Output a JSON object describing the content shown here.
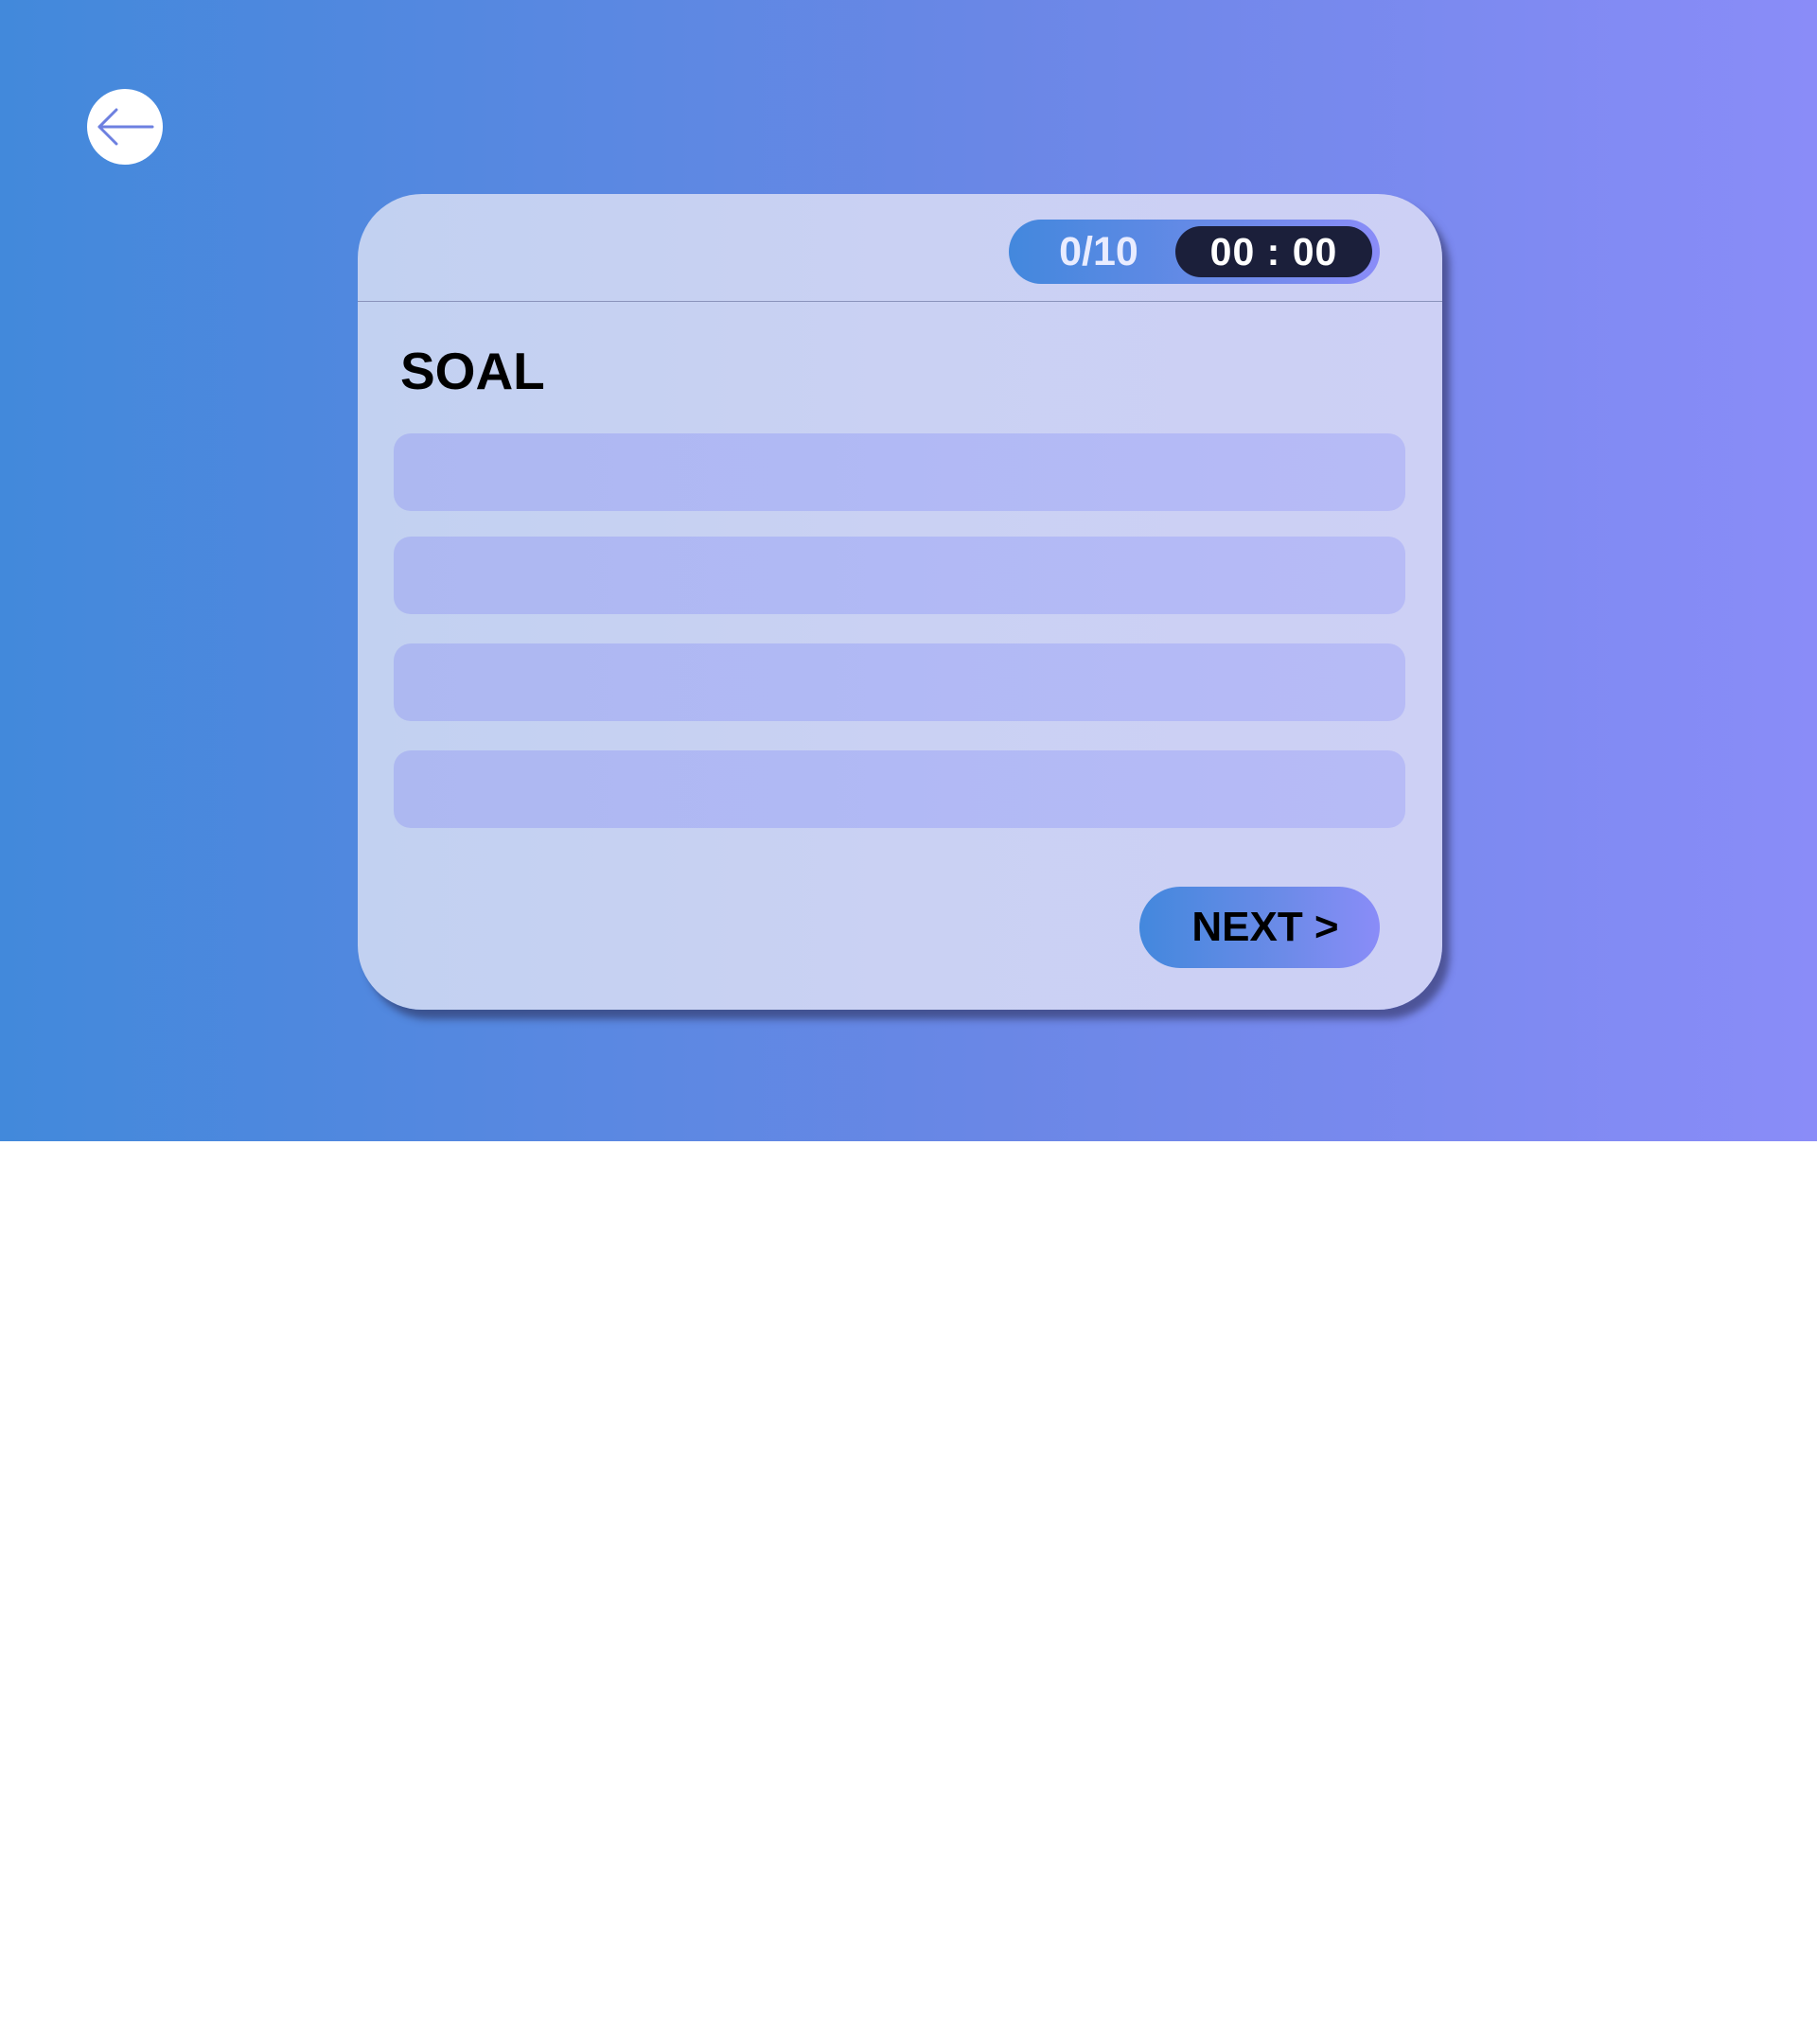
{
  "back_button": {
    "icon": "arrow-left-icon"
  },
  "quiz": {
    "progress": "0/10",
    "timer": "00 : 00",
    "question_title": "SOAL",
    "options": [
      "",
      "",
      "",
      ""
    ],
    "next_label": "NEXT >"
  },
  "colors": {
    "gradient_start": "#4289db",
    "gradient_end": "#8a8cf8",
    "card": "#c8d1f2",
    "option": "#b0b8f3",
    "timer_bg": "#1b1f3a"
  }
}
